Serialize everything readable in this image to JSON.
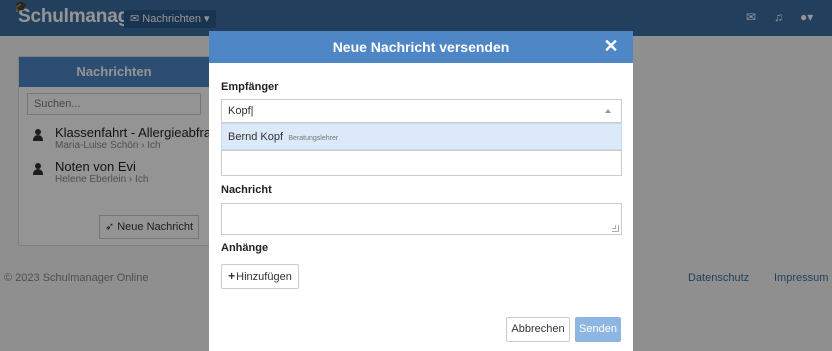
{
  "app": {
    "brand": "Schulmanager",
    "nav_pill": "Nachrichten",
    "nav_pill_icon": "speech-bubble-icon",
    "nav_icons": [
      "mail-icon",
      "bell-icon",
      "user-icon"
    ]
  },
  "sidebar": {
    "title": "Nachrichten",
    "search_placeholder": "Suchen...",
    "messages": [
      {
        "title": "Klassenfahrt - Allergieabfrage",
        "sub": "Maria-Luise Schön › Ich"
      },
      {
        "title": "Noten von Evi",
        "sub": "Helene Eberlein › Ich"
      }
    ],
    "new_button": "Neue Nachricht"
  },
  "footer": {
    "copyright": "© 2023 Schulmanager Online",
    "links": [
      "Datenschutz",
      "Impressum"
    ]
  },
  "modal": {
    "title": "Neue Nachricht versenden",
    "recipient_label": "Empfänger",
    "recipient_value": "Kopf",
    "suggestion": {
      "name": "Bernd Kopf",
      "role": "Beratungslehrer"
    },
    "message_label": "Nachricht",
    "attachments_label": "Anhänge",
    "add_button": "Hinzufügen",
    "cancel_button": "Abbrechen",
    "send_button": "Senden"
  },
  "colors": {
    "navbar": "#3c6ea3",
    "modal_header": "#4f86c6",
    "send_button": "#8db6e3",
    "suggestion_highlight": "#dbe9f8"
  }
}
